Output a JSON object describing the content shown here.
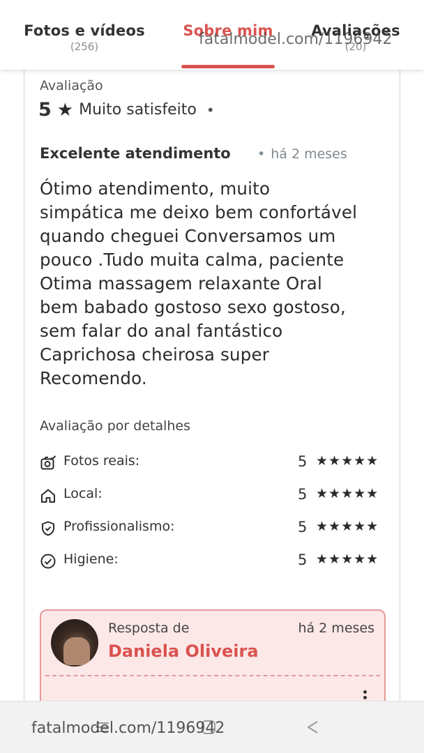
{
  "tabs": [
    {
      "label": "Fotos e vídeos",
      "count": "(256)"
    },
    {
      "label": "Sobre mim",
      "count": ""
    },
    {
      "label": "Avaliações",
      "count": "(20)"
    }
  ],
  "watermark": "fatalmodel.com/1196942",
  "review": {
    "section_label": "Avaliação",
    "score": "5",
    "score_icon": "star-icon",
    "score_text": "Muito satisfeito",
    "separator": "•",
    "title": "Excelente atendimento",
    "date": "há 2 meses",
    "body_lines": [
      "Ótimo atendimento, muito",
      "simpática me deixo bem confortável",
      "quando cheguei Conversamos um",
      "pouco .Tudo muita calma, paciente",
      "Otima massagem relaxante Oral",
      "bem babado gostoso sexo gostoso,",
      "sem falar do anal fantástico",
      "Caprichosa cheirosa super",
      "Recomendo."
    ]
  },
  "details": {
    "title": "Avaliação por detalhes",
    "items": [
      {
        "label": "Fotos reais:",
        "score": "5",
        "stars": "★★★★★",
        "icon": "camera-check-icon"
      },
      {
        "label": "Local:",
        "score": "5",
        "stars": "★★★★★",
        "icon": "home-icon"
      },
      {
        "label": "Profissionalismo:",
        "score": "5",
        "stars": "★★★★★",
        "icon": "shield-check-icon"
      },
      {
        "label": "Higiene:",
        "score": "5",
        "stars": "★★★★★",
        "icon": "check-circle-icon"
      }
    ]
  },
  "reply": {
    "from_label": "Resposta de",
    "name": "Daniela Oliveira",
    "date": "há 2 meses"
  },
  "colors": {
    "accent": "#d9534f",
    "reply_bg": "#fde8e8",
    "reply_border": "#e49a98"
  }
}
